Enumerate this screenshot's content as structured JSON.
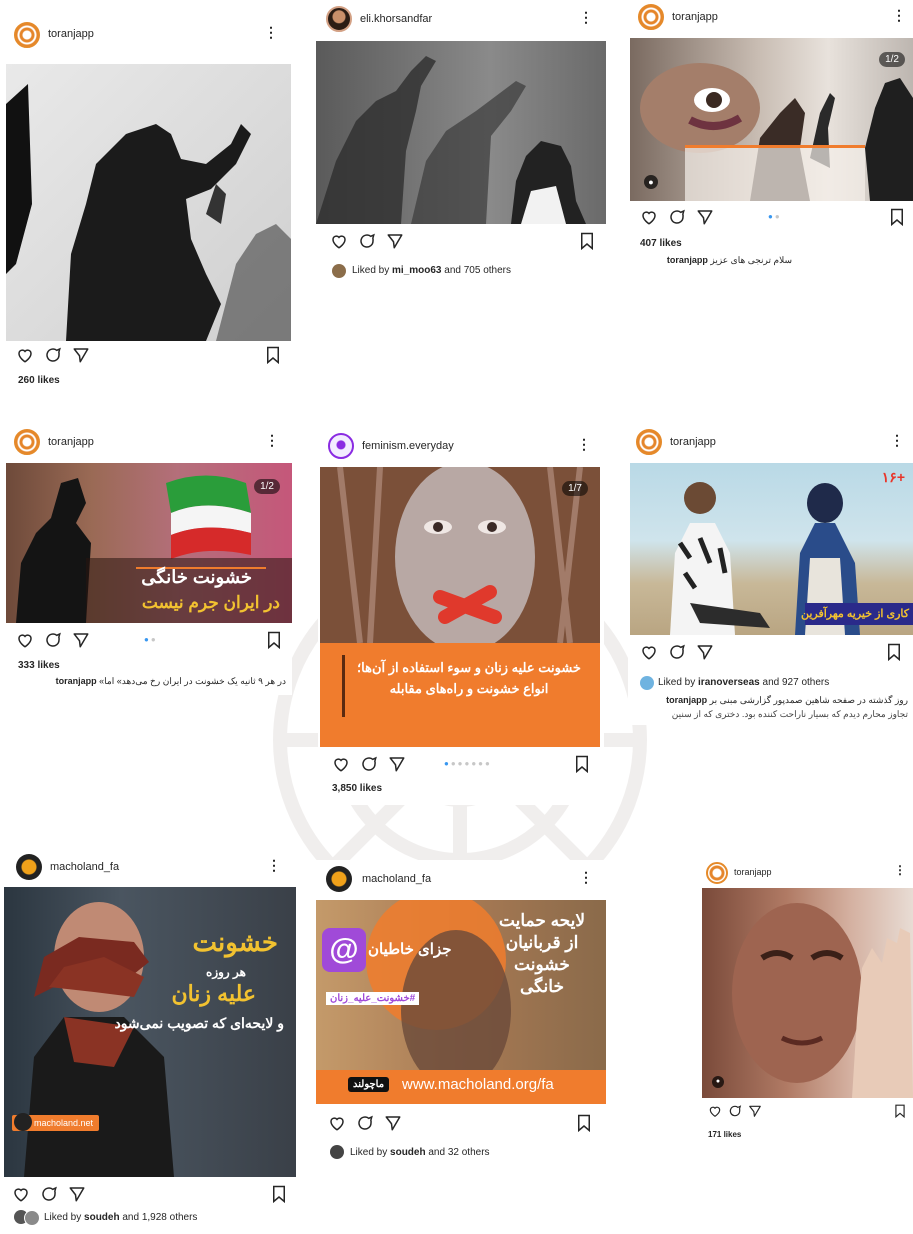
{
  "posts": [
    {
      "username": "toranjapp",
      "likes": "260 likes"
    },
    {
      "username": "eli.khorsandfar",
      "liked_by": "Liked by",
      "liked_user": "mi_moo63",
      "liked_rest": "and 705 others"
    },
    {
      "username": "toranjapp",
      "badge": "1/2",
      "likes": "407 likes",
      "caption_user": "toranjapp",
      "caption": "سلام ترنجی های عزیز"
    },
    {
      "username": "toranjapp",
      "badge": "1/2",
      "overlay_line1": "خشونت خانگی",
      "overlay_line2": "در ایران جرم نیست",
      "likes": "333 likes",
      "caption_user": "toranjapp",
      "caption": "در هر ۹ ثانیه یک خشونت در ایران رخ می‌دهد» اما»"
    },
    {
      "username": "feminism.everyday",
      "badge": "1/7",
      "overlay_text": "خشونت علیه زنان و سوء استفاده از آن‌ها؛ انواع خشونت و راه‌های مقابله",
      "likes": "3,850 likes"
    },
    {
      "username": "toranjapp",
      "overlay_tag": "۱۶+",
      "overlay_caption": "کاری از خیریه مهرآفرین",
      "liked_by": "Liked by",
      "liked_user": "iranoverseas",
      "liked_rest": "and 927 others",
      "caption_user": "toranjapp",
      "caption": "روز گذشته در صفحه شاهین صمدپور گزارشی مبنی بر",
      "caption2": "تجاوز محارم دیدم که بسیار ناراحت کننده بود. دختری که از سنین"
    },
    {
      "username": "macholand_fa",
      "overlay_line1": "خشونت",
      "overlay_line2": "هر روزه",
      "overlay_line3": "علیه زنان",
      "overlay_line4": "و لایحه‌ای که تصویب نمی‌شود",
      "overlay_site": "macholand.net",
      "liked_by": "Liked by",
      "liked_user": "soudeh",
      "liked_rest": "and 1,928 others"
    },
    {
      "username": "macholand_fa",
      "overlay_right": "لایحه حمایت از قربانیان خشونت خانگی",
      "overlay_left": "جزای خاطیان",
      "overlay_hash": "#خشونت_علیه_زنان",
      "overlay_url": "www.macholand.org/fa",
      "overlay_brand": "ماچولند",
      "liked_by": "Liked by",
      "liked_user": "soudeh",
      "liked_rest": "and 32 others"
    },
    {
      "username": "toranjapp",
      "likes": "171 likes"
    }
  ],
  "icons": [
    "heart-icon",
    "comment-icon",
    "share-icon",
    "bookmark-icon",
    "more-icon",
    "user-tag-icon"
  ],
  "colors": {
    "accent_orange": "#f07c2d",
    "link_blue": "#3897f0",
    "text": "#262626"
  }
}
